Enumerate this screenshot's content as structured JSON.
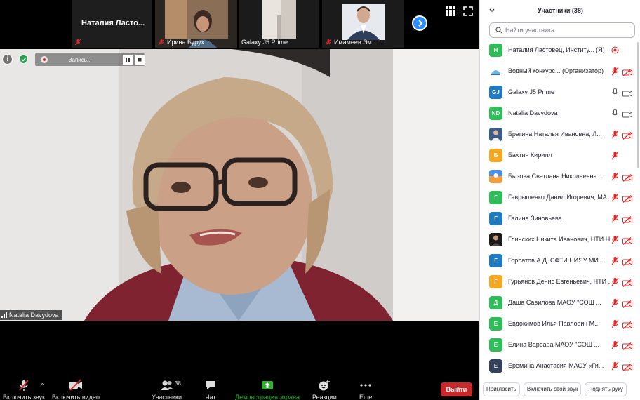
{
  "thumbnails": [
    {
      "name": "Наталия Ластовец, Институт...",
      "display": "Наталия  Ласто..."
    },
    {
      "name": "Ирина Бурух..."
    },
    {
      "name": "Galaxy J5 Prime"
    },
    {
      "name": "Имамеев Эм..."
    }
  ],
  "recording": {
    "label": "Запись..."
  },
  "main_speaker": {
    "name": "Natalia Davydova"
  },
  "toolbar": {
    "audio": "Включить звук",
    "video": "Включить видео",
    "participants": "Участники",
    "participants_count": "38",
    "chat": "Чат",
    "share": "Демонстрация экрана",
    "reactions": "Реакции",
    "more": "Еще",
    "exit": "Выйти"
  },
  "panel": {
    "title": "Участники (38)",
    "search_placeholder": "Найти участника",
    "participants": [
      {
        "initials": "Н",
        "color": "#2ebd59",
        "name": "Наталия Ластовец, Институ... (Я)",
        "mic": "host",
        "cam": "none"
      },
      {
        "initials": "",
        "color": "#ffffff",
        "avatar": "logo",
        "name": "Водный конкурс... (Организатор)",
        "mic": "muted",
        "cam": "off"
      },
      {
        "initials": "GJ",
        "color": "#1f7ac2",
        "name": "Galaxy J5 Prime",
        "mic": "on",
        "cam": "on"
      },
      {
        "initials": "ND",
        "color": "#2ebd59",
        "name": "Natalia Davydova",
        "mic": "on",
        "cam": "on"
      },
      {
        "initials": "",
        "color": "#4a6fa5",
        "avatar": "photo",
        "name": "Брагина Наталья Ивановна, Л...",
        "mic": "muted",
        "cam": "off"
      },
      {
        "initials": "Б",
        "color": "#f5a623",
        "name": "Бахтин Кирилл",
        "mic": "muted",
        "cam": "none"
      },
      {
        "initials": "",
        "color": "#3b7dd8",
        "avatar": "photo2",
        "name": "Бызова Светлана Николаевна ...",
        "mic": "muted",
        "cam": "off"
      },
      {
        "initials": "Г",
        "color": "#2ebd59",
        "name": "Гаврышенко Данил Игоревич, МА...",
        "mic": "muted",
        "cam": "off"
      },
      {
        "initials": "Г",
        "color": "#1f7ac2",
        "name": "Галина Зиновьева",
        "mic": "muted",
        "cam": "off"
      },
      {
        "initials": "",
        "color": "#222222",
        "avatar": "photo3",
        "name": "Глинских Никита Иванович, НТИ Н...",
        "mic": "muted",
        "cam": "off"
      },
      {
        "initials": "Г",
        "color": "#1f7ac2",
        "name": "Горбатов А.Д. СФТИ НИЯУ МИ...",
        "mic": "muted",
        "cam": "off"
      },
      {
        "initials": "Г",
        "color": "#f5a623",
        "name": "Гурьянов Денис Евгеньевич, НТИ ...",
        "mic": "muted",
        "cam": "off"
      },
      {
        "initials": "Д",
        "color": "#2ebd59",
        "name": "Даша Савилова МАОУ \"СОШ ...",
        "mic": "muted",
        "cam": "off"
      },
      {
        "initials": "Е",
        "color": "#2ebd59",
        "name": "Евдокимов Илья Павлович М...",
        "mic": "muted",
        "cam": "off"
      },
      {
        "initials": "Е",
        "color": "#2ebd59",
        "name": "Елина Варвара МАОУ \"СОШ ...",
        "mic": "muted",
        "cam": "off"
      },
      {
        "initials": "Е",
        "color": "#33415c",
        "name": "Еремина Анастасия МАОУ «Ги...",
        "mic": "muted",
        "cam": "off"
      }
    ],
    "footer": {
      "invite": "Пригласить",
      "unmute_me": "Включить свой звук",
      "raise_hand": "Поднять руку"
    }
  },
  "colors": {
    "accent": "#2d8cff",
    "exit": "#c8282a",
    "muted": "#e02828",
    "share": "#2fb22f"
  }
}
